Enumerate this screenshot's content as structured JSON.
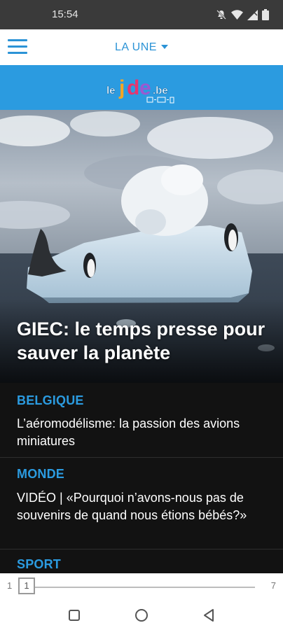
{
  "status_bar": {
    "time": "15:54"
  },
  "header": {
    "section_label": "LA UNE"
  },
  "logo": {
    "text_le": "le",
    "text_jde": "jde",
    "text_be": ".be"
  },
  "hero": {
    "title": "GIEC: le temps presse pour sauver la planète"
  },
  "articles": [
    {
      "category": "BELGIQUE",
      "headline": "L’aéromodélisme: la passion des avions miniatures"
    },
    {
      "category": "MONDE",
      "headline": "VIDÉO | «Pourquoi n’avons-nous pas de souvenirs de quand nous étions bébés?»"
    },
    {
      "category": "SPORT",
      "headline": ""
    }
  ],
  "pager": {
    "first": "1",
    "last": "7",
    "current": "1",
    "progress_fraction": 0.0
  },
  "colors": {
    "accent": "#2b93d6",
    "brand_bar": "#2b9be0",
    "dark_panel": "#121212"
  },
  "icons": {
    "menu": "hamburger-menu-icon",
    "caret": "caret-down-icon",
    "status": [
      "do-not-disturb-icon",
      "wifi-icon",
      "signal-icon",
      "battery-icon"
    ],
    "nav": [
      "recents-square-icon",
      "home-circle-icon",
      "back-triangle-icon"
    ]
  }
}
